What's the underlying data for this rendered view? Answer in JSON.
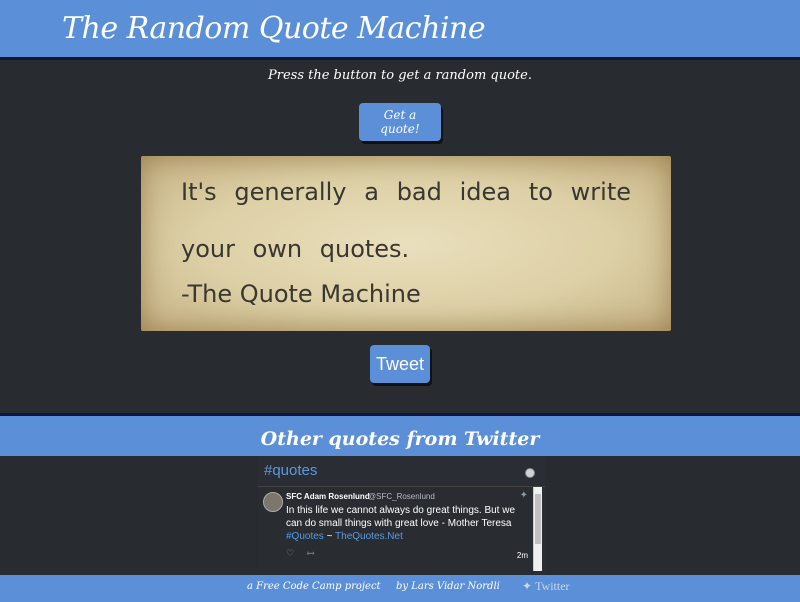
{
  "header": {
    "title": "The Random Quote Machine"
  },
  "main": {
    "instruction": "Press the button to get a random quote.",
    "get_quote_label": "Get a quote!",
    "quote_text": "It's generally a bad idea to write your own quotes.",
    "quote_author": "-The Quote Machine",
    "tweet_label": "Tweet"
  },
  "twitter_section": {
    "heading": "Other quotes from Twitter",
    "hashtag": "#quotes",
    "tweet": {
      "name": "SFC Adam Rosenlund",
      "handle": "@SFC_Rosenlund",
      "body": "In this life we cannot always do great things. But we can do small things with great love  - Mother Teresa",
      "tag": "#Quotes",
      "sep": " ~ ",
      "link": "TheQuotes.Net",
      "time": "2m"
    }
  },
  "footer": {
    "project": "a Free Code Camp project",
    "author": "by Lars Vidar Nordli",
    "twitter": "Twitter"
  },
  "colors": {
    "accent": "#5b8fd8",
    "background": "#282b30",
    "paper": "#e3d6b0"
  },
  "icons": {
    "twitter": "twitter-bird-icon",
    "info": "info-icon",
    "like": "heart-icon",
    "share": "share-icon"
  }
}
